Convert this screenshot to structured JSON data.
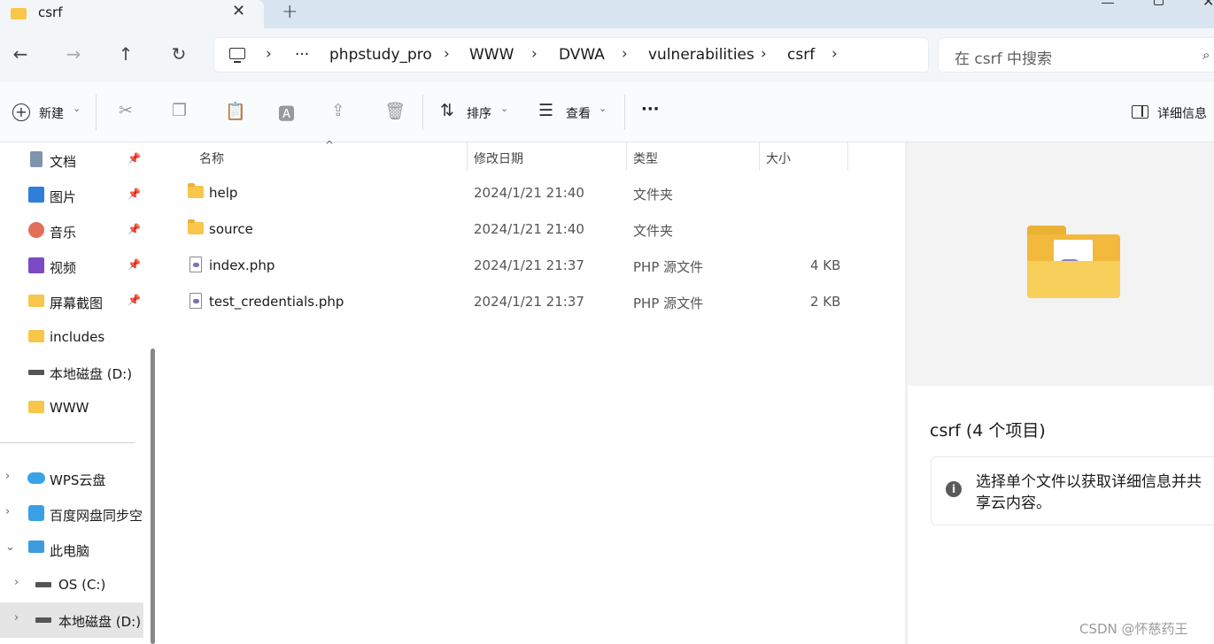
{
  "window": {
    "tab_title": "csrf",
    "tab_close": "✕",
    "new_tab": "+"
  },
  "nav": {
    "back": "←",
    "forward": "→",
    "up": "↑",
    "refresh": "↻",
    "breadcrumbs": [
      "···",
      "phpstudy_pro",
      "WWW",
      "DVWA",
      "vulnerabilities",
      "csrf"
    ],
    "separator": "›",
    "search_placeholder": "在 csrf 中搜索",
    "search_icon": "⌕"
  },
  "toolbar": {
    "new_label": "新建",
    "sort_label": "排序",
    "view_label": "查看",
    "more": "···",
    "details_label": "详细信息",
    "icons": [
      "cut-icon",
      "copy-icon",
      "paste-icon",
      "rename-icon",
      "share-icon",
      "delete-icon"
    ]
  },
  "sidebar": {
    "quick_access": [
      {
        "label": "文档",
        "icon": "documents-icon",
        "pinned": true
      },
      {
        "label": "图片",
        "icon": "pictures-icon",
        "pinned": true
      },
      {
        "label": "音乐",
        "icon": "music-icon",
        "pinned": true
      },
      {
        "label": "视频",
        "icon": "videos-icon",
        "pinned": true
      },
      {
        "label": "屏幕截图",
        "icon": "folder-icon",
        "pinned": true
      },
      {
        "label": "includes",
        "icon": "folder-icon",
        "pinned": false
      },
      {
        "label": "本地磁盘 (D:)",
        "icon": "drive-icon",
        "pinned": false
      },
      {
        "label": "WWW",
        "icon": "folder-icon",
        "pinned": false
      }
    ],
    "locations": [
      {
        "label": "WPS云盘",
        "icon": "cloud-icon",
        "chevron": "›"
      },
      {
        "label": "百度网盘同步空",
        "icon": "baidu-icon",
        "chevron": "›"
      },
      {
        "label": "此电脑",
        "icon": "computer-icon",
        "chevron": "⌄"
      },
      {
        "label": "OS (C:)",
        "icon": "drive-icon",
        "chevron": "›"
      },
      {
        "label": "本地磁盘 (D:)",
        "icon": "drive-icon",
        "chevron": "›"
      }
    ],
    "pin_glyph": "📌"
  },
  "filelist": {
    "columns": [
      "名称",
      "修改日期",
      "类型",
      "大小"
    ],
    "sort_indicator": "^",
    "files": [
      {
        "name": "help",
        "date": "2024/1/21 21:40",
        "type": "文件夹",
        "size": "",
        "kind": "folder"
      },
      {
        "name": "source",
        "date": "2024/1/21 21:40",
        "type": "文件夹",
        "size": "",
        "kind": "folder"
      },
      {
        "name": "index.php",
        "date": "2024/1/21 21:37",
        "type": "PHP 源文件",
        "size": "4 KB",
        "kind": "php"
      },
      {
        "name": "test_credentials.php",
        "date": "2024/1/21 21:37",
        "type": "PHP 源文件",
        "size": "2 KB",
        "kind": "php"
      }
    ]
  },
  "details": {
    "title": "csrf (4 个项目)",
    "info_icon": "i",
    "message": "选择单个文件以获取详细信息并共享云内容。"
  },
  "watermark": "CSDN @怀慈药王",
  "colors": {
    "titlebar": "#d9e4f1",
    "folder": "#f7c64a",
    "selected_row": "#e5e5e5"
  }
}
